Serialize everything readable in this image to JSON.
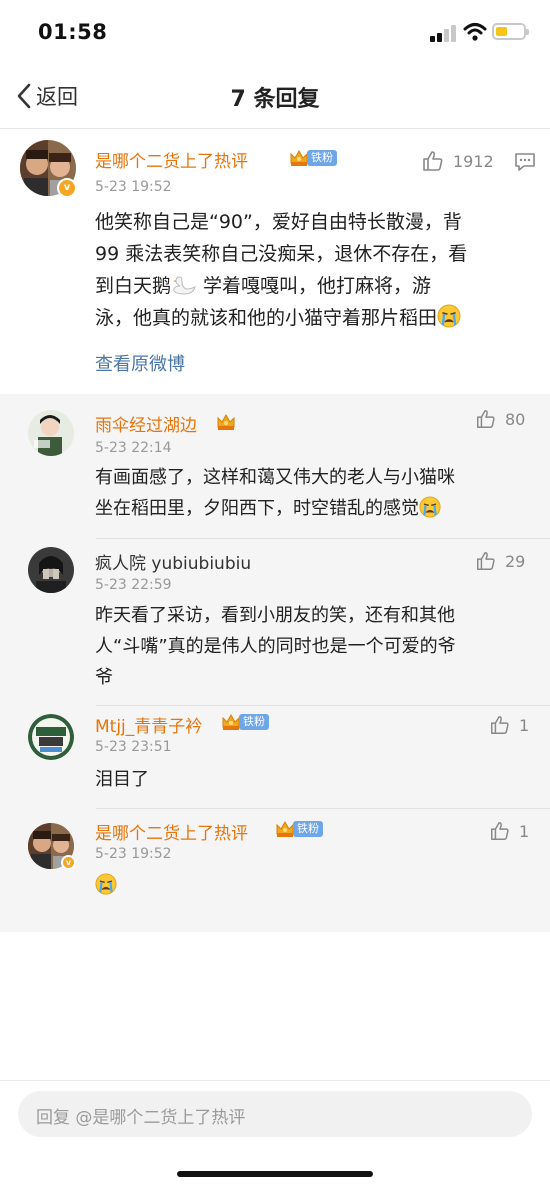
{
  "status": {
    "time": "01:58"
  },
  "nav": {
    "back_label": "返回",
    "title": "7 条回复"
  },
  "main_comment": {
    "username": "是哪个二货上了热评",
    "fan_badge": "铁粉",
    "timestamp": "5-23 19:52",
    "likes": "1912",
    "text_line1": "他笑称自己是“90”，爱好自由特长散漫，背",
    "text_line2": "99 乘法表笑称自己没痴呆，退休不存在，看",
    "text_line3a": "到白天鹅",
    "text_line3b": " 学着嘎嘎叫，他打麻将，游",
    "text_line4": "泳，他真的就该和他的小猫守着那片稻田",
    "view_original": "查看原微博"
  },
  "replies": [
    {
      "username": "雨伞经过湖边",
      "timestamp": "5-23 22:14",
      "likes": "80",
      "text_line1": "有画面感了，这样和蔼又伟大的老人与小猫咪",
      "text_line2": "坐在稻田里，夕阳西下，时空错乱的感觉"
    },
    {
      "username": "疯人院 yubiubiubiu",
      "timestamp": "5-23 22:59",
      "likes": "29",
      "text_line1": "昨天看了采访，看到小朋友的笑，还有和其他",
      "text_line2": "人“斗嘴”真的是伟人的同时也是一个可爱的爷",
      "text_line3": "爷"
    },
    {
      "username": "Mtjj_青青子衿",
      "fan_badge": "铁粉",
      "timestamp": "5-23 23:51",
      "likes": "1",
      "text_line1": "泪目了"
    },
    {
      "username": "是哪个二货上了热评",
      "fan_badge": "铁粉",
      "timestamp": "5-23 19:52",
      "likes": "1"
    }
  ],
  "reply_input": {
    "placeholder": "回复 @是哪个二货上了热评"
  },
  "colors": {
    "username": "#e8740c",
    "link": "#4a76a8",
    "fan_badge": "#6ea6e8",
    "battery": "#f5c518"
  },
  "icons": [
    "back-chevron-icon",
    "like-icon",
    "comment-icon",
    "crown-icon",
    "crying-emoji-icon",
    "swan-emoji-icon",
    "verified-icon",
    "signal-icon",
    "wifi-icon",
    "battery-icon"
  ]
}
